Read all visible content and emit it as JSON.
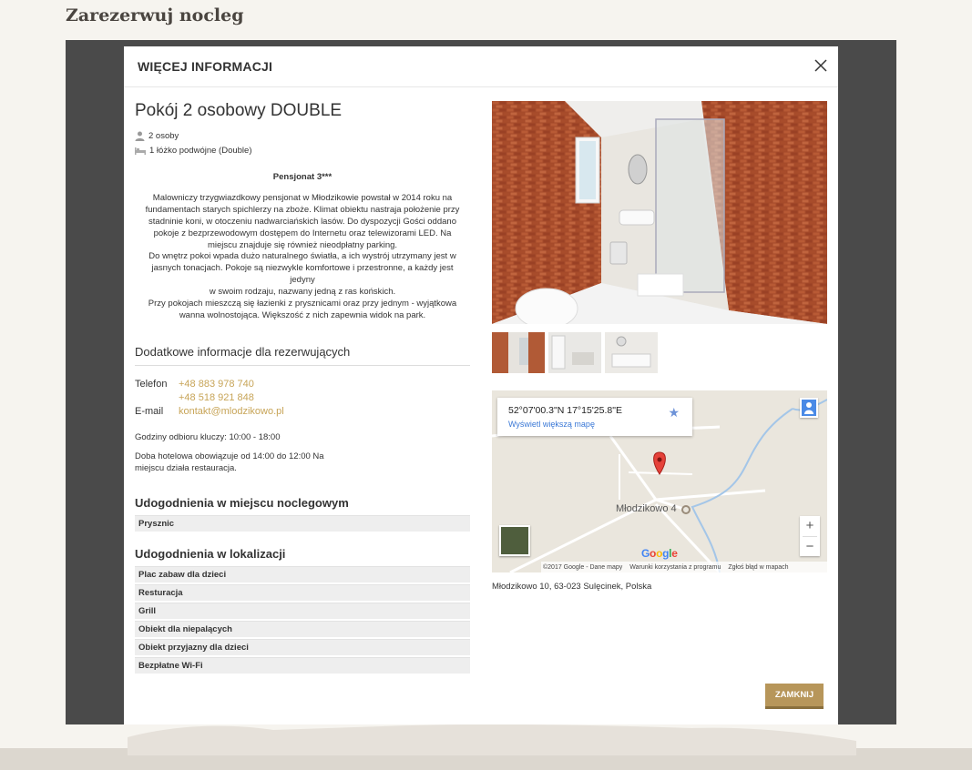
{
  "page": {
    "heading": "Zarezerwuj nocleg"
  },
  "modal": {
    "title": "WIĘCEJ INFORMACJI",
    "close_button_label": "ZAMKNIJ"
  },
  "room": {
    "title": "Pokój 2 osobowy DOUBLE",
    "capacity": "2 osoby",
    "beds": "1 łóżko podwójne (Double)"
  },
  "description": {
    "title": "Pensjonat 3***",
    "lines": [
      "Malowniczy trzygwiazdkowy pensjonat w Młodzikowie powstał w 2014 roku na",
      "fundamentach starych spichlerzy na zboże. Klimat obiektu nastraja położenie przy",
      "stadninie koni, w otoczeniu nadwarciańskich lasów. Do dyspozycji Gości oddano",
      "pokoje z bezprzewodowym dostępem do Internetu oraz telewizorami LED. Na",
      "miejscu znajduje się również nieodpłatny parking.",
      "Do wnętrz pokoi wpada dużo naturalnego światła, a ich wystrój utrzymany jest w",
      "jasnych tonacjach. Pokoje są niezwykle komfortowe i przestronne, a każdy jest jedyny",
      "w swoim rodzaju, nazwany jedną z ras końskich.",
      "Przy pokojach mieszczą się łazienki z prysznicami oraz przy jednym - wyjątkowa",
      "wanna wolnostojąca. Większość z nich zapewnia widok na park."
    ]
  },
  "info": {
    "heading": "Dodatkowe informacje dla rezerwujących",
    "phone_label": "Telefon",
    "phones": [
      "+48 883 978 740",
      "+48 518 921 848"
    ],
    "email_label": "E-mail",
    "email": "kontakt@mlodzikowo.pl",
    "key_hours": "Godziny odbioru kluczy: 10:00 - 18:00",
    "hotel_day_1": "Doba hotelowa obowiązuje od 14:00 do 12:00 Na",
    "hotel_day_2": "miejscu działa restauracja."
  },
  "amenities_room": {
    "heading": "Udogodnienia w miejscu noclegowym",
    "items": [
      "Prysznic"
    ]
  },
  "amenities_location": {
    "heading": "Udogodnienia w lokalizacji",
    "items": [
      "Plac zabaw dla dzieci",
      "Resturacja",
      "Grill",
      "Obiekt dla niepalących",
      "Obiekt przyjazny dla dzieci",
      "Bezpłatne Wi-Fi"
    ]
  },
  "map": {
    "coords": "52°07'00.3\"N 17°15'25.8\"E",
    "view_larger": "Wyświetl większą mapę",
    "place_label": "Młodzikowo 4",
    "logo": "Google",
    "footer_copyright": "©2017 Google - Dane mapy",
    "footer_terms": "Warunki korzystania z programu",
    "footer_report": "Zgłoś błąd w mapach",
    "zoom_in": "+",
    "zoom_out": "−"
  },
  "address": "Młodzikowo 10, 63-023 Sulęcinek, Polska",
  "colors": {
    "accent": "#c7a457",
    "button": "#b7965a",
    "overlay": "#4a4a4a"
  }
}
